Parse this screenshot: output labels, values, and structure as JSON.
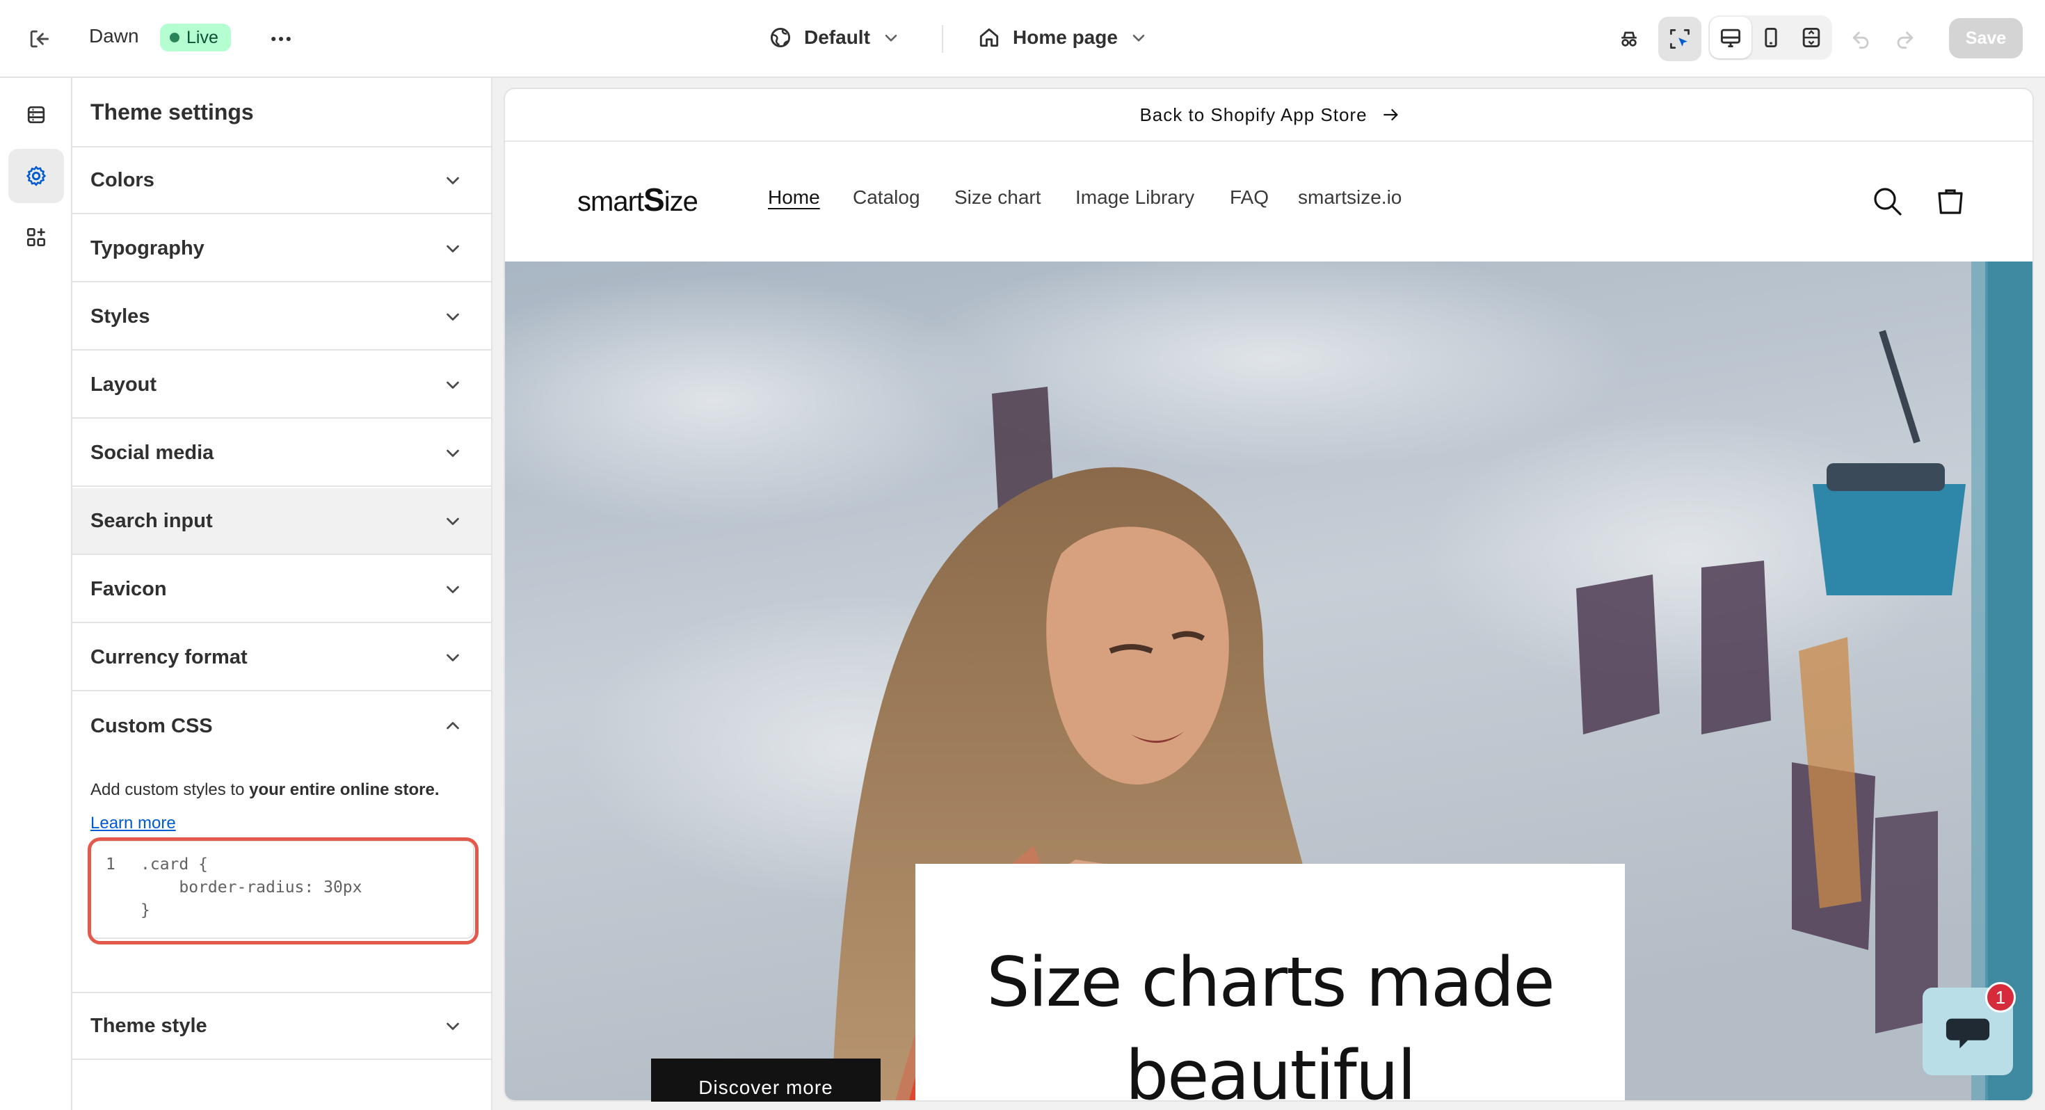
{
  "topbar": {
    "store_name": "Dawn",
    "status": "Live",
    "theme_picker": "Default",
    "page_picker": "Home page",
    "save_label": "Save"
  },
  "panel": {
    "title": "Theme settings",
    "sections": [
      {
        "label": "Colors",
        "state": "collapsed"
      },
      {
        "label": "Typography",
        "state": "collapsed"
      },
      {
        "label": "Styles",
        "state": "collapsed"
      },
      {
        "label": "Layout",
        "state": "collapsed"
      },
      {
        "label": "Social media",
        "state": "collapsed"
      },
      {
        "label": "Search input",
        "state": "hovered"
      },
      {
        "label": "Favicon",
        "state": "collapsed"
      },
      {
        "label": "Currency format",
        "state": "collapsed"
      },
      {
        "label": "Custom CSS",
        "state": "expanded"
      },
      {
        "label": "Theme style",
        "state": "collapsed"
      }
    ],
    "custom_css": {
      "help_prefix": "Add custom styles to ",
      "help_bold": "your entire online store.",
      "learn_more": "Learn more",
      "line_number": "1",
      "code_lines": [
        ".card {",
        "    border-radius: 30px",
        "}"
      ],
      "highlight_color": "#e35a4c"
    }
  },
  "preview": {
    "announcement": "Back to Shopify App Store",
    "logo_prefix": "smart",
    "logo_s": "S",
    "logo_suffix": "ize",
    "nav": [
      "Home",
      "Catalog",
      "Size chart",
      "Image Library",
      "FAQ",
      "smartsize.io"
    ],
    "hero_heading": "Size charts made beautiful",
    "hero_button": "Discover more"
  },
  "chat": {
    "unread_count": "1"
  },
  "colors": {
    "accent": "#005bd3",
    "live_badge_bg": "#b4fed2",
    "chat_bg": "#b9dee7",
    "badge_red": "#d62b3a"
  }
}
